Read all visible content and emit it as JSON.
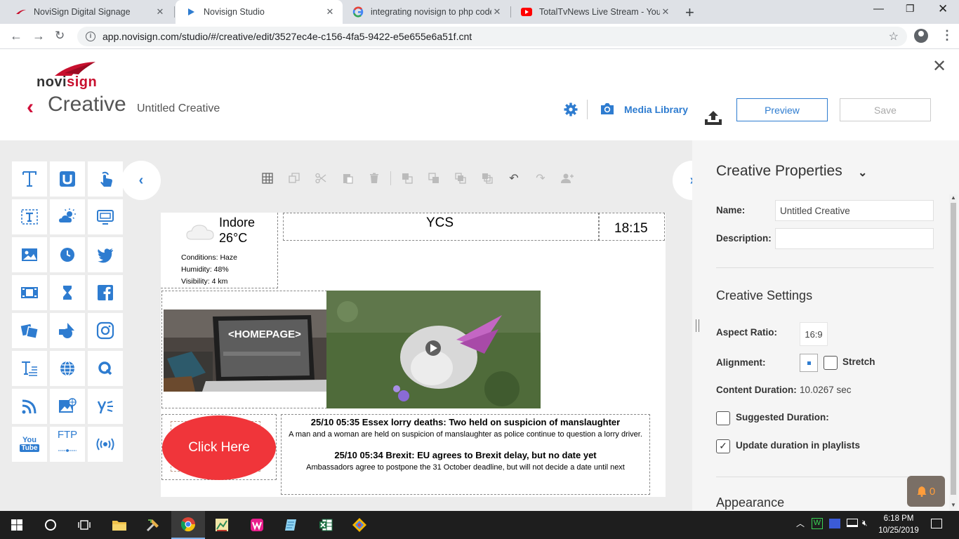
{
  "browser": {
    "tabs": [
      {
        "label": "NoviSign Digital Signage",
        "icon": "novisign-favicon"
      },
      {
        "label": "Novisign Studio",
        "icon": "play-favicon"
      },
      {
        "label": "integrating novisign to php code",
        "icon": "google-favicon"
      },
      {
        "label": "TotalTvNews Live Stream - YouTu",
        "icon": "youtube-favicon"
      }
    ],
    "url": "app.novisign.com/studio/#/creative/edit/3527ec4e-c156-4fa5-9422-e5e655e6a51f.cnt"
  },
  "header": {
    "logo": "novisign",
    "title": "Creative",
    "creative_name": "Untitled Creative",
    "media_library": "Media Library",
    "preview": "Preview",
    "save": "Save"
  },
  "palette": {
    "tools": [
      "text-tool-icon",
      "ticker-tool-icon",
      "touch-tool-icon",
      "text-box-icon",
      "weather-icon",
      "screen-icon",
      "image-icon",
      "clock-icon",
      "twitter-icon",
      "video-icon",
      "countdown-icon",
      "facebook-icon",
      "slideshow-icon",
      "shapes-icon",
      "instagram-icon",
      "rich-text-icon",
      "web-page-icon",
      "qr-icon",
      "rss-icon",
      "web-image-icon",
      "yammer-icon",
      "youtube-icon",
      "ftp-icon",
      "stream-icon"
    ],
    "youtube_label_top": "You",
    "youtube_label_bottom": "Tube",
    "ftp_label": "FTP"
  },
  "canvas": {
    "weather": {
      "city": "Indore",
      "temp": "26°C",
      "conditions": "Conditions: Haze",
      "humidity": "Humidity: 48%",
      "visibility": "Visibility: 4 km"
    },
    "title_text": "YCS",
    "clock": "18:15",
    "laptop_text": "<HOMEPAGE>",
    "button_text": "Click Here",
    "news": [
      {
        "headline": "25/10 05:35 Essex lorry deaths: Two held on suspicion of manslaughter",
        "body": "A man and a woman are held on suspicion of manslaughter as police continue to question a lorry driver."
      },
      {
        "headline": "25/10 05:34 Brexit: EU agrees to Brexit delay, but no date yet",
        "body": "Ambassadors agree to postpone the 31 October deadline, but will not decide a date until next"
      }
    ]
  },
  "properties": {
    "title": "Creative Properties",
    "name_label": "Name:",
    "name_value": "Untitled Creative",
    "description_label": "Description:",
    "description_value": "",
    "settings_title": "Creative Settings",
    "aspect_label": "Aspect Ratio:",
    "aspect_value": "16:9",
    "alignment_label": "Alignment:",
    "stretch_label": "Stretch",
    "duration_label": "Content Duration:",
    "duration_value": "10.0267 sec",
    "suggested_label": "Suggested Duration:",
    "update_label": "Update duration in playlists",
    "appearance_title": "Appearance",
    "notifications": "0"
  },
  "taskbar": {
    "time": "6:18 PM",
    "date": "10/25/2019"
  },
  "colors": {
    "accent": "#2e7cd0",
    "brand": "#c8102e",
    "click_button": "#f0353a"
  }
}
